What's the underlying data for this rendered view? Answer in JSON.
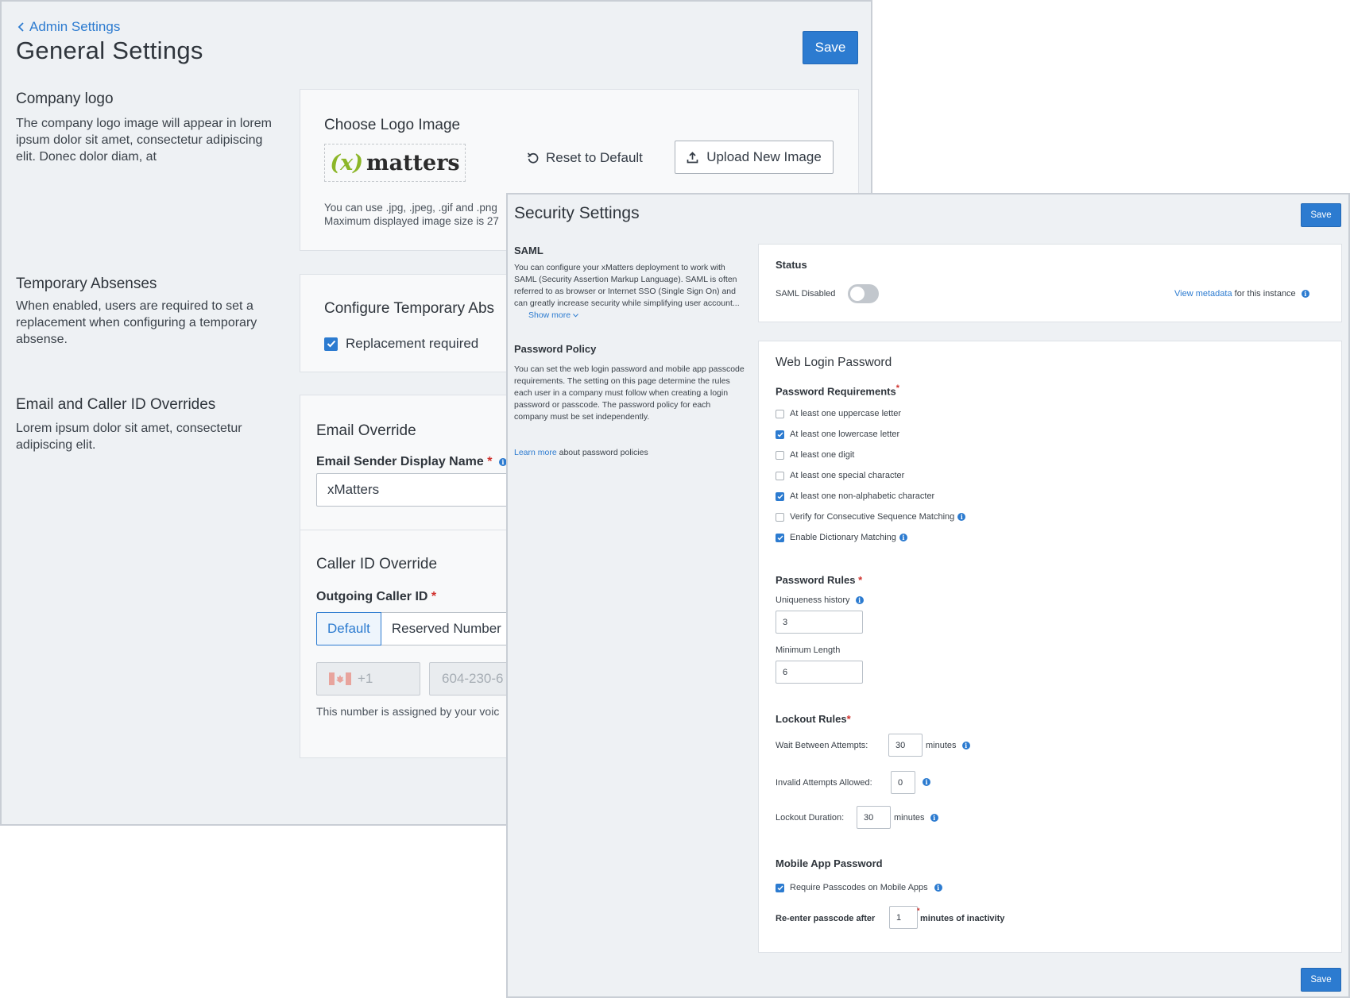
{
  "general": {
    "back_label": "Admin Settings",
    "title": "General Settings",
    "save_label": "Save",
    "logo_section": {
      "title": "Company logo",
      "description": "The company logo image will appear in lorem ipsum dolor sit amet, consectetur adipiscing elit. Donec dolor diam, at",
      "card_title": "Choose Logo Image",
      "logo_text": "matters",
      "logo_mark": "(x)",
      "reset_label": "Reset to Default",
      "upload_label": "Upload New Image",
      "hint_line1": "You can use .jpg, .jpeg, .gif and .png",
      "hint_line2": "Maximum displayed image size is 27"
    },
    "absence_section": {
      "title": "Temporary Absenses",
      "description": "When enabled, users are required to set a replacement when configuring a temporary absense.",
      "card_title": "Configure Temporary Abs",
      "checkbox_label": "Replacement required",
      "checked": true
    },
    "override_section": {
      "title": "Email and Caller ID Overrides",
      "description": "Lorem ipsum dolor sit amet, consectetur adipiscing elit.",
      "email_title": "Email Override",
      "email_label": "Email Sender Display Name",
      "email_value": "xMatters",
      "caller_title": "Caller ID Override",
      "caller_label": "Outgoing Caller ID",
      "options": [
        "Default",
        "Reserved Number"
      ],
      "selected_option": "Default",
      "country_code": "+1",
      "phone_placeholder": "604-230-6",
      "phone_hint": "This number is assigned by your voic"
    }
  },
  "security": {
    "title": "Security Settings",
    "save_label": "Save",
    "saml": {
      "heading": "SAML",
      "description": "You can configure your xMatters deployment to work with SAML (Security Assertion Markup Language). SAML is often referred to as browser or Internet SSO (Single Sign On) and can greatly increase security while simplifying user account...",
      "show_more": "Show more",
      "status_heading": "Status",
      "status_label": "SAML Disabled",
      "enabled": false,
      "metadata_link": "View metadata",
      "metadata_suffix": "for this instance"
    },
    "password_policy": {
      "heading": "Password Policy",
      "description": "You can set the web login password and mobile app passcode requirements. The setting on this page determine the rules each user in a company must follow when creating a login password or passcode. The password policy for each company must be set independently.",
      "learn_more": "Learn more",
      "learn_more_suffix": "about password policies"
    },
    "web_login": {
      "title": "Web Login Password",
      "requirements_heading": "Password Requirements",
      "requirements": [
        {
          "label": "At least one uppercase letter",
          "checked": false
        },
        {
          "label": "At least one lowercase letter",
          "checked": true
        },
        {
          "label": "At least one digit",
          "checked": false
        },
        {
          "label": "At least one special character",
          "checked": false
        },
        {
          "label": "At least one non-alphabetic character",
          "checked": true
        },
        {
          "label": "Verify for Consecutive Sequence Matching",
          "checked": false
        },
        {
          "label": "Enable Dictionary Matching",
          "checked": true
        }
      ],
      "rules_heading": "Password Rules",
      "uniqueness_label": "Uniqueness history",
      "uniqueness_value": "3",
      "min_length_label": "Minimum Length",
      "min_length_value": "6",
      "lockout_heading": "Lockout Rules",
      "wait_label": "Wait Between Attempts:",
      "wait_value": "30",
      "wait_unit": "minutes",
      "invalid_label": "Invalid Attempts Allowed:",
      "invalid_value": "0",
      "duration_label": "Lockout Duration:",
      "duration_value": "30",
      "duration_unit": "minutes",
      "mobile_heading": "Mobile App Password",
      "mobile_checkbox": "Require Passcodes on Mobile Apps",
      "mobile_checked": true,
      "reenter_label": "Re-enter passcode after",
      "reenter_value": "1",
      "reenter_suffix": "minutes of inactivity"
    },
    "colors": {
      "accent": "#2c7bd0",
      "required": "#d0312d",
      "logo_green": "#8cb628"
    }
  }
}
